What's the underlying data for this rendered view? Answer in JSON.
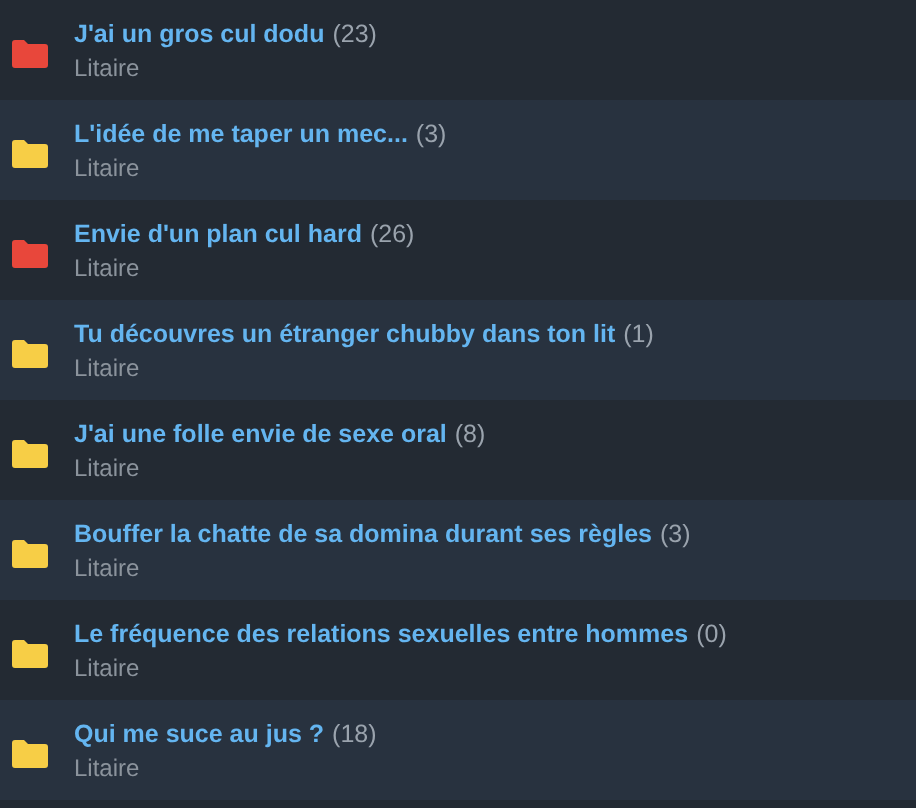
{
  "threads": [
    {
      "title": "J'ai un gros cul dodu",
      "count": "(23)",
      "author": "Litaire",
      "color": "#e8473b"
    },
    {
      "title": "L'idée de me taper un mec...",
      "count": "(3)",
      "author": "Litaire",
      "color": "#f7ce46"
    },
    {
      "title": "Envie d'un plan cul hard",
      "count": "(26)",
      "author": "Litaire",
      "color": "#e8473b"
    },
    {
      "title": "Tu découvres un étranger chubby dans ton lit",
      "count": "(1)",
      "author": "Litaire",
      "color": "#f7ce46"
    },
    {
      "title": "J'ai une folle envie de sexe oral",
      "count": "(8)",
      "author": "Litaire",
      "color": "#f7ce46"
    },
    {
      "title": "Bouffer la chatte de sa domina durant ses règles",
      "count": "(3)",
      "author": "Litaire",
      "color": "#f7ce46"
    },
    {
      "title": "Le fréquence des relations sexuelles entre hommes",
      "count": "(0)",
      "author": "Litaire",
      "color": "#f7ce46"
    },
    {
      "title": "Qui me suce au jus ?",
      "count": "(18)",
      "author": "Litaire",
      "color": "#f7ce46"
    }
  ]
}
